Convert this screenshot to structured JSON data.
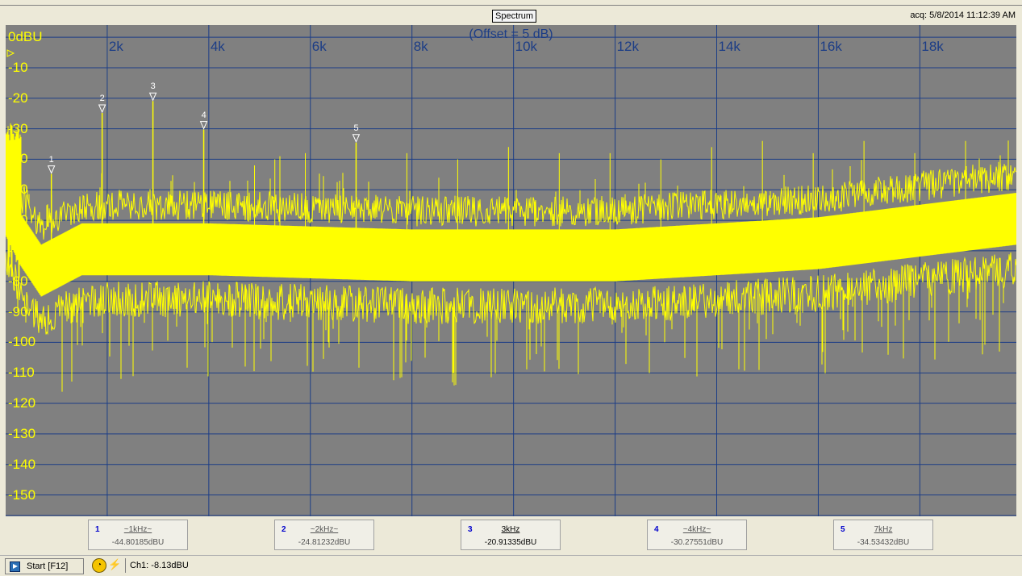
{
  "window": {
    "title": "Spectrum",
    "acq": "acq: 5/8/2014 11:12:39 AM"
  },
  "plot": {
    "offset_label": "(Offset = 5 dB)",
    "x_ticks": [
      "2k",
      "4k",
      "6k",
      "8k",
      "10k",
      "12k",
      "14k",
      "16k",
      "18k"
    ],
    "y_ticks": [
      "0dBU",
      "-10",
      "-20",
      "-30",
      "-40",
      "-50",
      "-60",
      "-70",
      "-80",
      "-90",
      "-100",
      "-110",
      "-120",
      "-130",
      "-140",
      "-150"
    ],
    "trace_color": "#ffff00",
    "grid_color": "#1c3d86",
    "background_color": "#808080"
  },
  "chart_data": {
    "type": "line",
    "x_axis": {
      "unit": "Hz",
      "range": [
        0,
        19900
      ]
    },
    "y_axis": {
      "unit": "dBU",
      "range": [
        -157,
        4
      ]
    },
    "grid": true,
    "markers": [
      {
        "id": "1",
        "freq_hz": 900,
        "level_dbu": -44.80185
      },
      {
        "id": "2",
        "freq_hz": 1900,
        "level_dbu": -24.81232
      },
      {
        "id": "3",
        "freq_hz": 2900,
        "level_dbu": -20.91335
      },
      {
        "id": "4",
        "freq_hz": 3900,
        "level_dbu": -30.27551
      },
      {
        "id": "5",
        "freq_hz": 6900,
        "level_dbu": -34.53432
      }
    ],
    "noise_floor_dbu": [
      [
        0,
        -55
      ],
      [
        300,
        -65
      ],
      [
        700,
        -75
      ],
      [
        1500,
        -68
      ],
      [
        4000,
        -68
      ],
      [
        8000,
        -70
      ],
      [
        12000,
        -70
      ],
      [
        16000,
        -66
      ],
      [
        19900,
        -58
      ]
    ],
    "harmonic_spurs_dbu": [
      [
        4900,
        -42
      ],
      [
        5300,
        -40
      ],
      [
        5400,
        -39
      ],
      [
        5900,
        -38
      ],
      [
        7900,
        -38
      ],
      [
        8900,
        -40
      ],
      [
        9900,
        -36
      ],
      [
        10900,
        -38
      ],
      [
        11900,
        -38
      ],
      [
        12900,
        -40
      ],
      [
        13900,
        -36
      ],
      [
        14900,
        -34
      ],
      [
        15900,
        -38
      ],
      [
        16900,
        -34
      ],
      [
        17900,
        -38
      ],
      [
        18900,
        -34
      ]
    ]
  },
  "markers_panel": [
    {
      "num": "1",
      "freq": "~1kHz~",
      "value": "-44.80185dBU",
      "active": false
    },
    {
      "num": "2",
      "freq": "~2kHz~",
      "value": "-24.81232dBU",
      "active": false
    },
    {
      "num": "3",
      "freq": "3kHz",
      "value": "-20.91335dBU",
      "active": true
    },
    {
      "num": "4",
      "freq": "~4kHz~",
      "value": "-30.27551dBU",
      "active": false
    },
    {
      "num": "5",
      "freq": "7kHz",
      "value": "-34.53432dBU",
      "active": false
    }
  ],
  "status": {
    "start_label": "Start [F12]",
    "channel": "Ch1: -8.13dBU"
  }
}
